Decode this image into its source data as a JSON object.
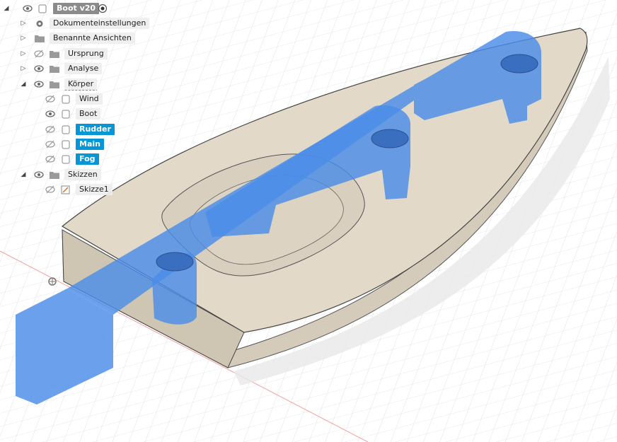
{
  "browser": {
    "root": {
      "label": "Boot v20"
    },
    "items": [
      {
        "label": "Dokumenteinstellungen",
        "icon": "gear-icon"
      },
      {
        "label": "Benannte Ansichten",
        "icon": "folder-icon"
      },
      {
        "label": "Ursprung",
        "icon": "folder-icon",
        "visible": false
      },
      {
        "label": "Analyse",
        "icon": "folder-icon",
        "visible": true
      },
      {
        "label": "Körper",
        "icon": "folder-icon",
        "visible": true,
        "expanded": true
      },
      {
        "label": "Skizzen",
        "icon": "folder-icon",
        "visible": true,
        "expanded": true
      }
    ],
    "bodies": [
      {
        "label": "Wind",
        "visible": false,
        "selected": false
      },
      {
        "label": "Boot",
        "visible": true,
        "selected": false
      },
      {
        "label": "Rudder",
        "visible": false,
        "selected": true
      },
      {
        "label": "Main",
        "visible": false,
        "selected": true
      },
      {
        "label": "Fog",
        "visible": false,
        "selected": true
      }
    ],
    "sketches": [
      {
        "label": "Skizze1",
        "visible": false
      }
    ]
  },
  "colors": {
    "selection": "#0696d7",
    "body_fill": "#e2d9c9",
    "highlight": "#4a8ce8",
    "grid": "#d8d8d8"
  }
}
